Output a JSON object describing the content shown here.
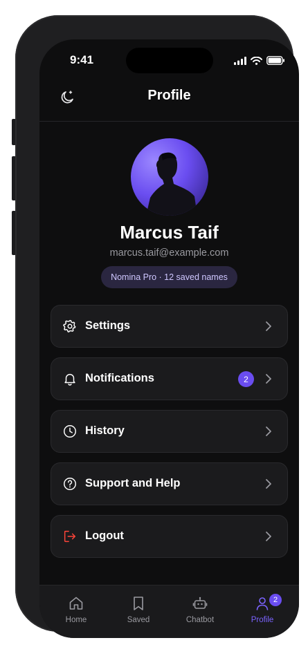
{
  "status_bar": {
    "time": "9:41"
  },
  "header": {
    "title": "Profile",
    "theme_icon": "moon-icon"
  },
  "profile": {
    "name": "Marcus Taif",
    "email": "marcus.taif@example.com",
    "plan": "Nomina Pro · 12 saved names"
  },
  "menu": {
    "items": [
      {
        "label": "Settings",
        "icon": "gear-icon"
      },
      {
        "label": "Notifications",
        "icon": "bell-icon",
        "badge": "2"
      },
      {
        "label": "History",
        "icon": "clock-icon"
      },
      {
        "label": "Support and Help",
        "icon": "help-icon"
      },
      {
        "label": "Logout",
        "icon": "logout-icon",
        "icon_color": "#ff453a"
      }
    ]
  },
  "tabbar": {
    "tabs": [
      {
        "label": "Home",
        "icon": "home-icon"
      },
      {
        "label": "Saved",
        "icon": "bookmark-icon"
      },
      {
        "label": "Chatbot",
        "icon": "robot-icon"
      },
      {
        "label": "Profile",
        "icon": "user-icon",
        "active": true,
        "badge": "2"
      }
    ]
  },
  "colors": {
    "accent": "#6a4df0",
    "active_tab": "#7b63ff",
    "background": "#0e0e0f",
    "card": "#1b1b1d",
    "logout": "#ff453a"
  }
}
